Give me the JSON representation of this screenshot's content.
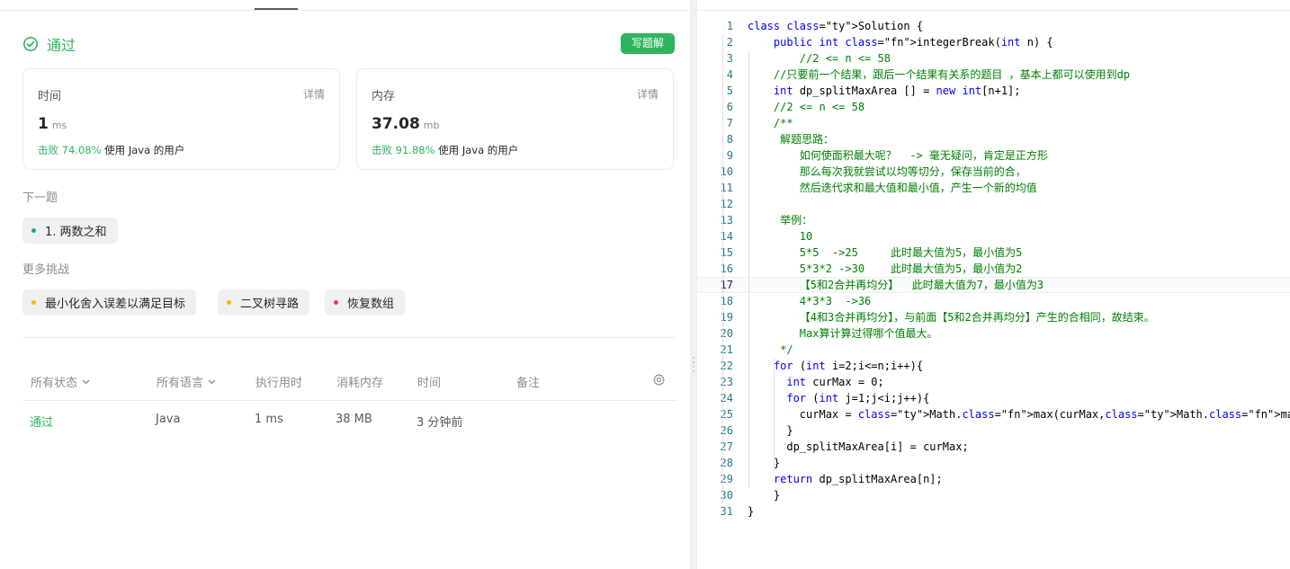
{
  "result": {
    "status": "通过",
    "solution_button": "写题解",
    "runtime": {
      "title": "时间",
      "detail": "详情",
      "value": "1",
      "unit": "ms",
      "beat_pct": "击败 74.08%",
      "beat_text": "使用 Java 的用户"
    },
    "memory": {
      "title": "内存",
      "detail": "详情",
      "value": "37.08",
      "unit": "mb",
      "beat_pct": "击败 91.88%",
      "beat_text": "使用 Java 的用户"
    }
  },
  "next": {
    "label": "下一题",
    "problem": "1. 两数之和",
    "problem_color": "#00af9b"
  },
  "more": {
    "label": "更多挑战",
    "items": [
      {
        "title": "最小化舍入误差以满足目标",
        "color": "#ffb800"
      },
      {
        "title": "二叉树寻路",
        "color": "#ffb800"
      },
      {
        "title": "恢复数组",
        "color": "#ff2d55"
      }
    ]
  },
  "submissions": {
    "headers": [
      "所有状态",
      "所有语言",
      "执行用时",
      "消耗内存",
      "时间",
      "备注"
    ],
    "rows": [
      {
        "status": "通过",
        "lang": "Java",
        "runtime": "1 ms",
        "memory": "38 MB",
        "time": "3 分钟前"
      }
    ]
  },
  "editor": {
    "active_line": 17,
    "lines": [
      "class Solution {",
      "    public int integerBreak(int n) {",
      "        //2 <= n <= 58",
      "    //只要前一个结果，跟后一个结果有关系的题目 ，基本上都可以使用到dp",
      "    int dp_splitMaxArea [] = new int[n+1];",
      "    //2 <= n <= 58",
      "    /**",
      "     解题思路：",
      "        如何使面积最大呢？  -> 毫无疑问，肯定是正方形",
      "        那么每次我就尝试以均等切分，保存当前的合，",
      "        然后迭代求和最大值和最小值，产生一个新的均值",
      "",
      "     举例：",
      "        10",
      "        5*5  ->25     此时最大值为5，最小值为5",
      "        5*3*2 ->30    此时最大值为5，最小值为2",
      "        【5和2合并再均分】  此时最大值为7，最小值为3",
      "        4*3*3  ->36",
      "        【4和3合并再均分】，与前面【5和2合并再均分】产生的合相同，故结束。",
      "        Max算计算过得哪个值最大。",
      "     */",
      "    for (int i=2;i<=n;i++){",
      "      int curMax = 0;",
      "      for (int j=1;j<i;j++){",
      "        curMax = Math.max(curMax,Math.max(j*(i-j),j * dp_splitMaxArea[i-j]));",
      "      }",
      "      dp_splitMaxArea[i] = curMax;",
      "    }",
      "    return dp_splitMaxArea[n];",
      "    }",
      "}"
    ]
  },
  "colors": {
    "accent": "#2db55d",
    "keyword": "#0000ff",
    "comment": "#008000",
    "line_number": "#237893"
  }
}
